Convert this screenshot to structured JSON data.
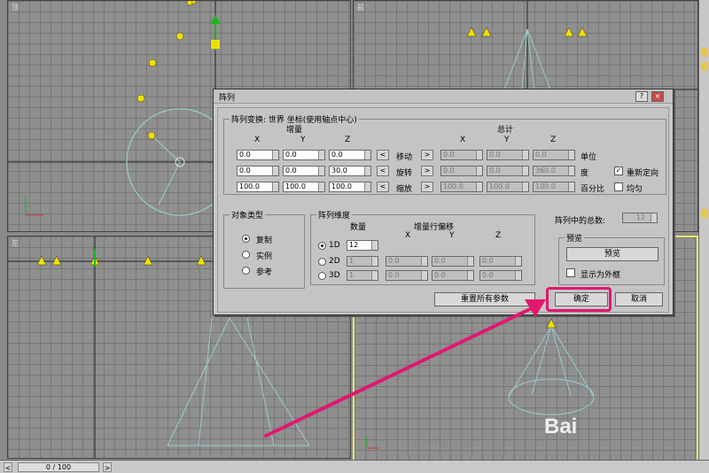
{
  "viewports": {
    "top_label": "顶",
    "front_label": "前",
    "left_label": "左",
    "perspective_label": ""
  },
  "timebar": {
    "frame": "0 / 100",
    "prev": "<",
    "next": ">"
  },
  "dialog": {
    "title": "阵列",
    "help": "?",
    "close": "×",
    "transform_group": "阵列变换: 世界 坐标(使用轴点中心)",
    "increment_header": "增量",
    "total_header": "总计",
    "axes": [
      "X",
      "Y",
      "Z"
    ],
    "rows": [
      {
        "label": "移动",
        "inc": [
          "0.0",
          "0.0",
          "0.0"
        ],
        "total": [
          "0.0",
          "0.0",
          "0.0"
        ],
        "unit": "单位"
      },
      {
        "label": "旋转",
        "inc": [
          "0.0",
          "0.0",
          "30.0"
        ],
        "total": [
          "0.0",
          "0.0",
          "360.0"
        ],
        "unit": "度"
      },
      {
        "label": "缩放",
        "inc": [
          "100.0",
          "100.0",
          "100.0"
        ],
        "total": [
          "100.0",
          "100.0",
          "100.0"
        ],
        "unit": "百分比"
      }
    ],
    "left_arrow": "<",
    "right_arrow": ">",
    "reorient_label": "重新定向",
    "reorient_checked": "✓",
    "uniform_label": "均匀",
    "object_type_group": "对象类型",
    "object_types": [
      "复制",
      "实例",
      "参考"
    ],
    "dimensions_group": "阵列维度",
    "count_header": "数量",
    "offset_header": "增量行偏移",
    "dims": [
      {
        "label": "1D",
        "count": "12",
        "offsets": []
      },
      {
        "label": "2D",
        "count": "1",
        "offsets": [
          "0.0",
          "0.0",
          "0.0"
        ]
      },
      {
        "label": "3D",
        "count": "1",
        "offsets": [
          "0.0",
          "0.0",
          "0.0"
        ]
      }
    ],
    "total_in_array_label": "阵列中的总数:",
    "total_in_array_value": "12",
    "preview_group": "预览",
    "preview_button": "预览",
    "show_as_box_label": "显示为外框",
    "reset_button": "重置所有参数",
    "ok_button": "确定",
    "cancel_button": "取消"
  },
  "watermark": "Bai",
  "colors": {
    "highlight": "#e0186f",
    "active_viewport": "#e8e86a",
    "light_icon": "#f0e000"
  }
}
